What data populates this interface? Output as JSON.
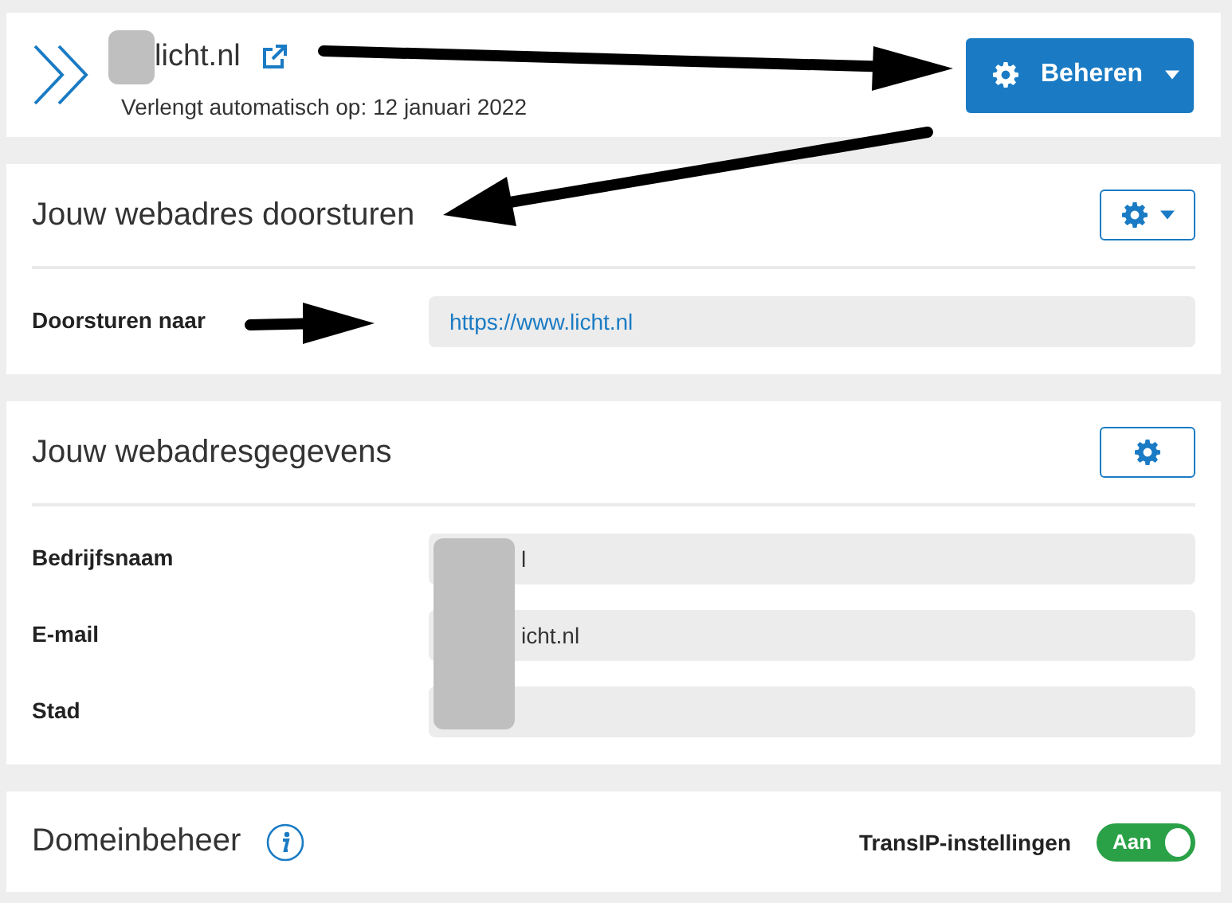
{
  "header": {
    "domain": "licht.nl",
    "renewal": "Verlengt automatisch op: 12 januari 2022",
    "manage_button": "Beheren"
  },
  "forwarding": {
    "title": "Jouw webadres doorsturen",
    "settings_dropdown": true,
    "rows": [
      {
        "label": "Doorsturen naar",
        "value": "https://www.licht.nl",
        "kind": "link"
      }
    ]
  },
  "details": {
    "title": "Jouw webadresgegevens",
    "settings_dropdown": false,
    "rows": [
      {
        "label": "Bedrijfsnaam",
        "value": "l"
      },
      {
        "label": "E-mail",
        "value": "icht.nl"
      },
      {
        "label": "Stad"
      }
    ]
  },
  "domain_management": {
    "title": "Domeinbeheer",
    "setting_label": "TransIP-instellingen",
    "toggle": {
      "label": "Aan",
      "on": true
    }
  }
}
